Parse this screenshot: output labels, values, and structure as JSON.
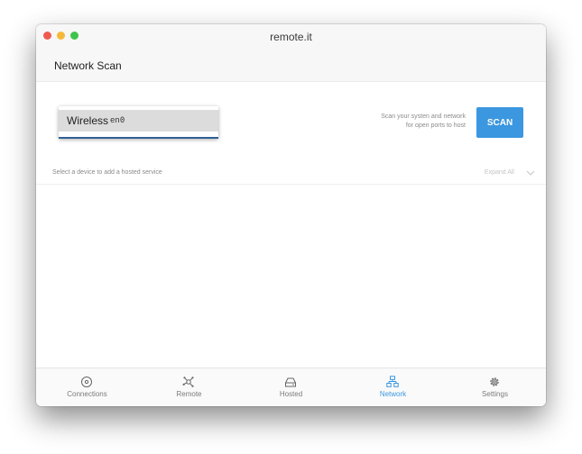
{
  "window": {
    "title": "remote.it"
  },
  "header": {
    "title": "Network Scan"
  },
  "scan": {
    "interface_name": "Wireless",
    "interface_device": "en0",
    "description_line1": "Scan your systen and network",
    "description_line2": "for open ports to host",
    "button_label": "SCAN"
  },
  "list": {
    "hint": "Select a device to add a hosted service",
    "expand_label": "Expand All"
  },
  "nav": {
    "items": [
      {
        "label": "Connections",
        "icon": "connections-icon"
      },
      {
        "label": "Remote",
        "icon": "remote-icon"
      },
      {
        "label": "Hosted",
        "icon": "hosted-icon"
      },
      {
        "label": "Network",
        "icon": "network-icon",
        "active": true
      },
      {
        "label": "Settings",
        "icon": "settings-icon"
      }
    ]
  },
  "colors": {
    "accent": "#3b97e0",
    "close": "#ef5a4f",
    "minimize": "#f5b93a",
    "maximize": "#3fc449"
  }
}
